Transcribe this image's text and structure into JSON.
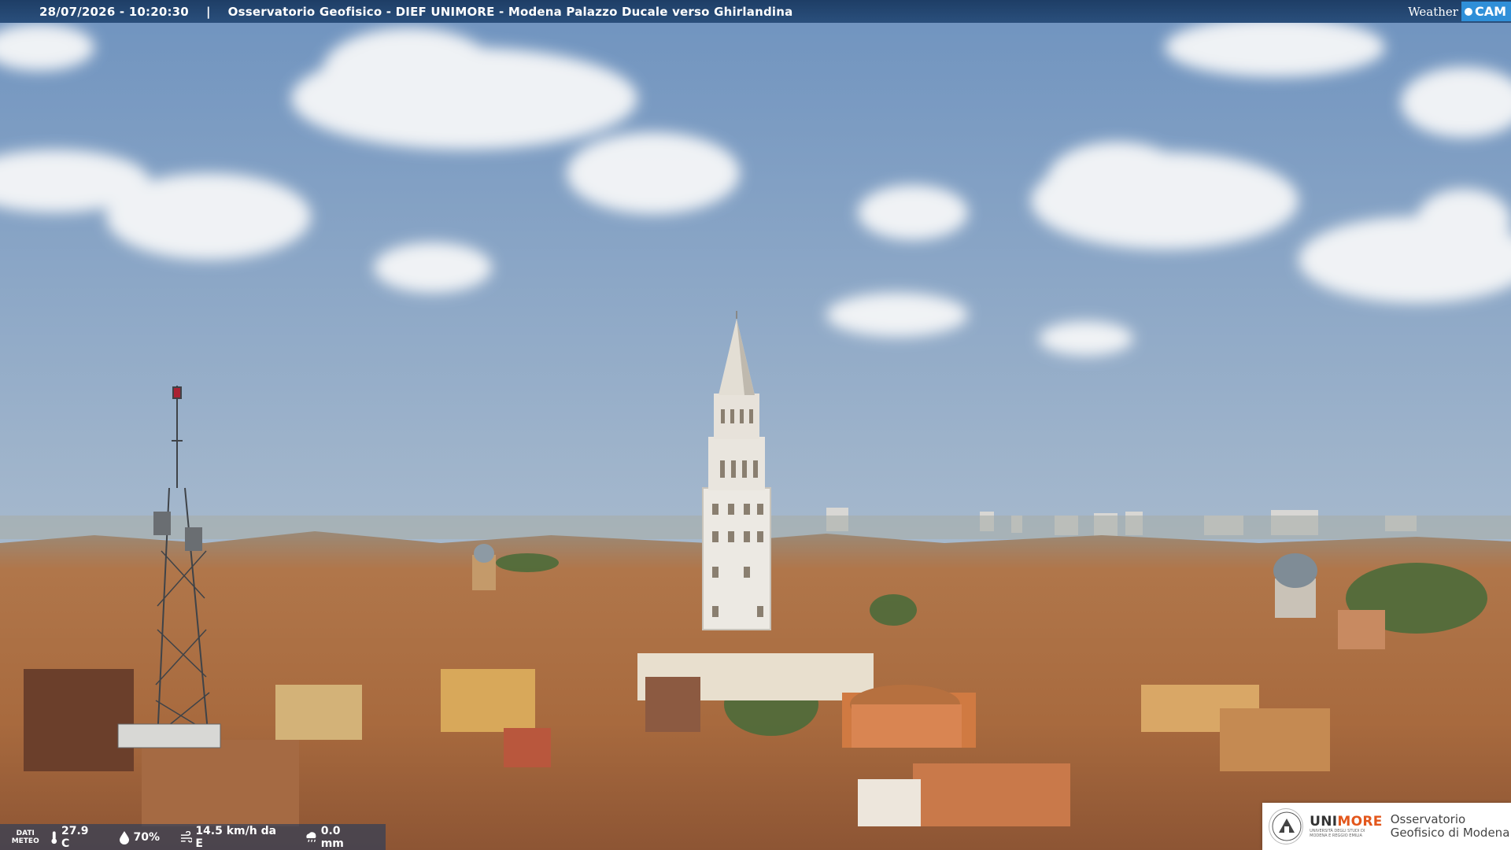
{
  "header": {
    "timestamp": "28/07/2026 - 10:20:30",
    "separator": "|",
    "camera_title": "Osservatorio Geofisico - DIEF UNIMORE - Modena Palazzo Ducale verso Ghirlandina"
  },
  "brand": {
    "weather": "Weather",
    "cam": "CAM"
  },
  "meteo": {
    "label_line1": "DATI",
    "label_line2": "METEO",
    "temperature": "27.9 C",
    "humidity": "70%",
    "wind": "14.5 km/h da E",
    "rain": "0.0 mm",
    "icons": [
      "thermometer-icon",
      "humidity-drop-icon",
      "wind-icon",
      "rain-icon"
    ]
  },
  "logo": {
    "uni_a": "UNI",
    "uni_b": "MORE",
    "uni_sub": "UNIVERSITÀ DEGLI STUDI DI MODENA E REGGIO EMILIA",
    "observatory": "Osservatorio Geofisico di Modena",
    "accent": "#e3571c"
  },
  "colors": {
    "sky_top": "#7f9ec3",
    "sky_horizon": "#b9c6d2",
    "roof": "#b5703f",
    "bar": "#1e3e66"
  }
}
